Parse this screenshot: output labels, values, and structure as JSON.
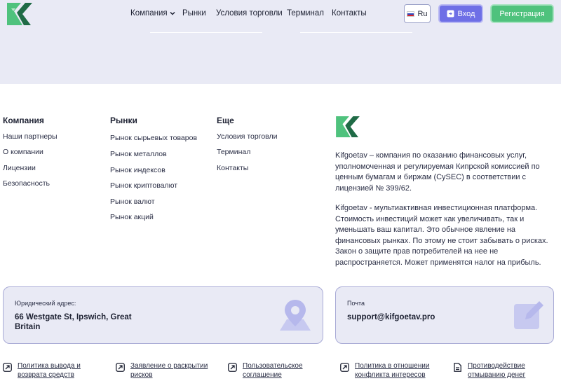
{
  "header": {
    "nav": [
      {
        "label": "Компания",
        "has_dropdown": true
      },
      {
        "label": "Рынки"
      },
      {
        "label": "Условия торговли"
      },
      {
        "label": "Терминал"
      },
      {
        "label": "Контакты"
      }
    ],
    "lang_label": "Ru",
    "login_label": "Вход",
    "register_label": "Регистрация"
  },
  "footer": {
    "columns": [
      {
        "title": "Компания",
        "links": [
          "Наши партнеры",
          "О компании",
          "Лицензии",
          "Безопасность"
        ]
      },
      {
        "title": "Рынки",
        "links": [
          "Рынок сырьевых товаров",
          "Рынок металлов",
          "Рынок индексов",
          "Рынок криптовалют",
          "Рынок валют",
          "Рынок акций"
        ]
      },
      {
        "title": "Еще",
        "links": [
          "Условия торговли",
          "Терминал",
          "Контакты"
        ]
      }
    ],
    "about_p1": "Kifgoetav – компания по оказанию финансовых услуг, уполномоченная и регулируемая Кипрской комиссией по ценным бумагам и биржам (CySEC) в соответствии с лицензией № 399/62.",
    "about_p2": "Kifgoetav - мультиактивная инвестиционная платформа. Стоимость инвестиций может как увеличивать, так и уменьшать ваш капитал. Это обычное явление на финансовых рынках. По этому не стоит забывать о рисках. Закон о защите прав потребителей на нее не распространяется. Может применятся налог на прибыль.",
    "address_card": {
      "label": "Юридический адрес:",
      "value": "66 Westgate St, Ipswich, Great Britain"
    },
    "email_card": {
      "label": "Почта",
      "value": "support@kifgoetav.pro"
    },
    "policies": [
      "Политика вывода и возврата средств",
      "Заявление о раскрытии рисков",
      "Пользовательское соглашение",
      "Политика в отношении конфликта интересов",
      "Противодействие отмыванию денег"
    ]
  },
  "colors": {
    "brand_green": "#4fc27d",
    "accent_purple": "#6e6fe6",
    "hero_bg": "#e9eaf5"
  }
}
